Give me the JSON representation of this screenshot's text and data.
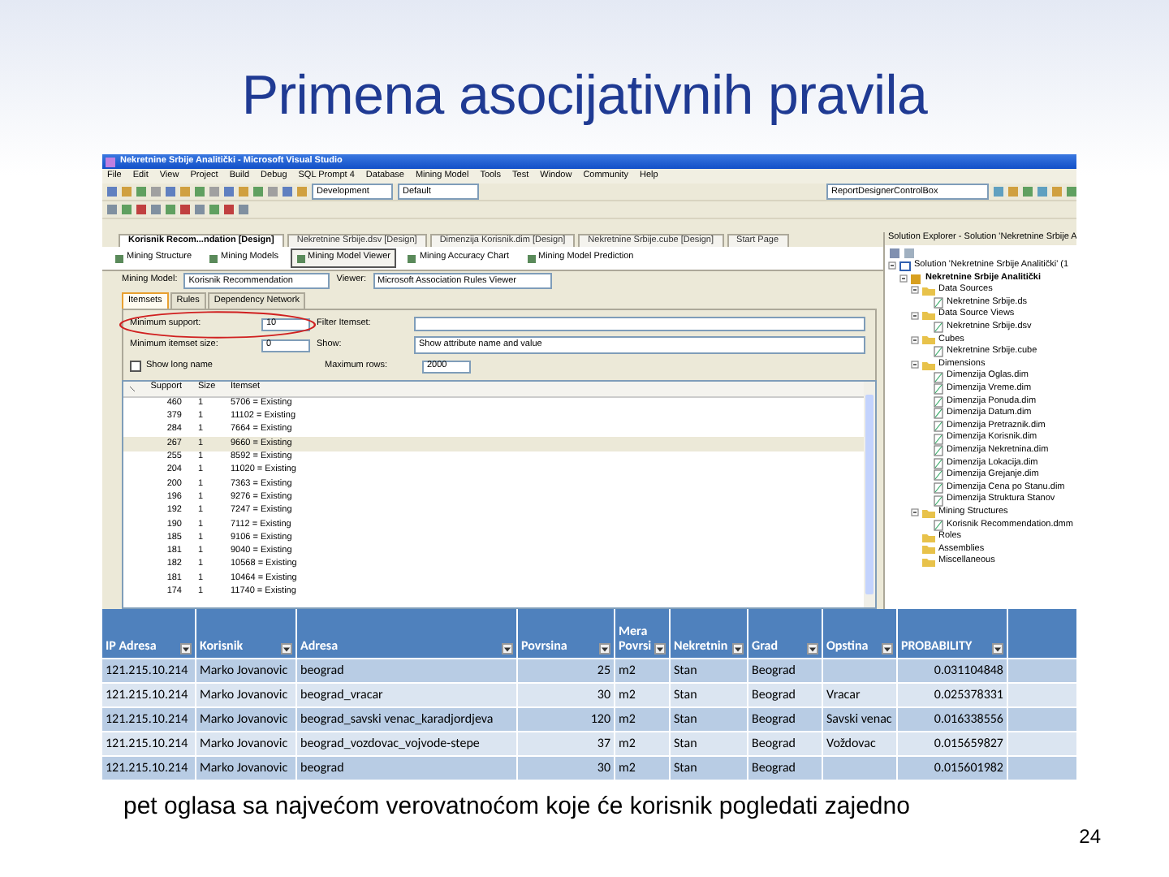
{
  "slide": {
    "title": "Primena asocijativnih pravila",
    "caption": "pet oglasa sa najvećom verovatnoćom  koje će korisnik pogledati zajedno",
    "page_number": "24"
  },
  "window": {
    "title": "Nekretnine Srbije Analitički - Microsoft Visual Studio"
  },
  "menu": [
    "File",
    "Edit",
    "View",
    "Project",
    "Build",
    "Debug",
    "SQL Prompt 4",
    "Database",
    "Mining Model",
    "Tools",
    "Test",
    "Window",
    "Community",
    "Help"
  ],
  "toolbar": {
    "configuration": "Development",
    "platform": "Default",
    "find_box": "ReportDesignerControlBox"
  },
  "document_tabs": [
    {
      "label": "Korisnik Recom...ndation [Design]",
      "selected": true
    },
    {
      "label": "Nekretnine Srbije.dsv [Design]",
      "selected": false
    },
    {
      "label": "Dimenzija Korisnik.dim [Design]",
      "selected": false
    },
    {
      "label": "Nekretnine Srbije.cube [Design]",
      "selected": false
    },
    {
      "label": "Start Page",
      "selected": false
    }
  ],
  "designer_tabs": [
    {
      "label": "Mining Structure",
      "selected": false
    },
    {
      "label": "Mining Models",
      "selected": false
    },
    {
      "label": "Mining Model Viewer",
      "selected": true
    },
    {
      "label": "Mining Accuracy Chart",
      "selected": false
    },
    {
      "label": "Mining Model Prediction",
      "selected": false
    }
  ],
  "mining_model": {
    "label": "Mining Model:",
    "value": "Korisnik Recommendation"
  },
  "viewer": {
    "label": "Viewer:",
    "value": "Microsoft Association Rules Viewer"
  },
  "viewer_tabs": [
    {
      "label": "Itemsets",
      "selected": true
    },
    {
      "label": "Rules",
      "selected": false
    },
    {
      "label": "Dependency Network",
      "selected": false
    }
  ],
  "form": {
    "min_support_label": "Minimum support:",
    "min_support": "10",
    "min_size_label": "Minimum itemset size:",
    "min_size": "0",
    "long_name_label": "Show long name",
    "long_name_checked": false,
    "filter_label": "Filter Itemset:",
    "show_label": "Show:",
    "show_value": "Show attribute name and value",
    "max_rows_label": "Maximum rows:",
    "max_rows": "2000"
  },
  "itemsets": {
    "columns": [
      "Support",
      "Size",
      "Itemset"
    ],
    "rows": [
      {
        "support": "460",
        "size": "1",
        "itemset": "5706 = Existing",
        "selected": false
      },
      {
        "support": "379",
        "size": "1",
        "itemset": "11102 = Existing",
        "selected": false
      },
      {
        "support": "284",
        "size": "1",
        "itemset": "7664 = Existing",
        "selected": false
      },
      {
        "support": "267",
        "size": "1",
        "itemset": "9660 = Existing",
        "selected": true
      },
      {
        "support": "255",
        "size": "1",
        "itemset": "8592 = Existing",
        "selected": false
      },
      {
        "support": "204",
        "size": "1",
        "itemset": "11020 = Existing",
        "selected": false
      },
      {
        "support": "200",
        "size": "1",
        "itemset": "7363 = Existing",
        "selected": false
      },
      {
        "support": "196",
        "size": "1",
        "itemset": "9276 = Existing",
        "selected": false
      },
      {
        "support": "192",
        "size": "1",
        "itemset": "7247 = Existing",
        "selected": false
      },
      {
        "support": "190",
        "size": "1",
        "itemset": "7112 = Existing",
        "selected": false
      },
      {
        "support": "185",
        "size": "1",
        "itemset": "9106 = Existing",
        "selected": false
      },
      {
        "support": "181",
        "size": "1",
        "itemset": "9040 = Existing",
        "selected": false
      },
      {
        "support": "182",
        "size": "1",
        "itemset": "10568 = Existing",
        "selected": false
      },
      {
        "support": "181",
        "size": "1",
        "itemset": "10464 = Existing",
        "selected": false
      },
      {
        "support": "174",
        "size": "1",
        "itemset": "11740 = Existing",
        "selected": false
      }
    ]
  },
  "solution_explorer": {
    "title": "Solution Explorer - Solution 'Nekretnine Srbije A",
    "tree": [
      {
        "label": "Solution 'Nekretnine Srbije Analitički' (1",
        "kind": "solution",
        "expanded": true,
        "children": [
          {
            "label": "Nekretnine Srbije Analitički",
            "kind": "project",
            "expanded": true,
            "children": [
              {
                "label": "Data Sources",
                "kind": "folder",
                "expanded": true,
                "children": [
                  {
                    "label": "Nekretnine Srbije.ds",
                    "kind": "file"
                  }
                ]
              },
              {
                "label": "Data Source Views",
                "kind": "folder",
                "expanded": true,
                "children": [
                  {
                    "label": "Nekretnine Srbije.dsv",
                    "kind": "file"
                  }
                ]
              },
              {
                "label": "Cubes",
                "kind": "folder",
                "expanded": true,
                "children": [
                  {
                    "label": "Nekretnine Srbije.cube",
                    "kind": "file"
                  }
                ]
              },
              {
                "label": "Dimensions",
                "kind": "folder",
                "expanded": true,
                "children": [
                  {
                    "label": "Dimenzija Oglas.dim",
                    "kind": "file"
                  },
                  {
                    "label": "Dimenzija Vreme.dim",
                    "kind": "file"
                  },
                  {
                    "label": "Dimenzija Ponuda.dim",
                    "kind": "file"
                  },
                  {
                    "label": "Dimenzija Datum.dim",
                    "kind": "file"
                  },
                  {
                    "label": "Dimenzija Pretraznik.dim",
                    "kind": "file"
                  },
                  {
                    "label": "Dimenzija Korisnik.dim",
                    "kind": "file"
                  },
                  {
                    "label": "Dimenzija Nekretnina.dim",
                    "kind": "file"
                  },
                  {
                    "label": "Dimenzija Lokacija.dim",
                    "kind": "file"
                  },
                  {
                    "label": "Dimenzija Grejanje.dim",
                    "kind": "file"
                  },
                  {
                    "label": "Dimenzija Cena po Stanu.dim",
                    "kind": "file"
                  },
                  {
                    "label": "Dimenzija Struktura Stanov",
                    "kind": "file"
                  }
                ]
              },
              {
                "label": "Mining Structures",
                "kind": "folder",
                "expanded": true,
                "children": [
                  {
                    "label": "Korisnik Recommendation.dmm",
                    "kind": "file"
                  }
                ]
              },
              {
                "label": "Roles",
                "kind": "folder"
              },
              {
                "label": "Assemblies",
                "kind": "folder"
              },
              {
                "label": "Miscellaneous",
                "kind": "folder"
              }
            ]
          }
        ]
      }
    ]
  },
  "results": {
    "columns": [
      "IP Adresa",
      "Korisnik",
      "Adresa",
      "Povrsina",
      "Mera Povrsi",
      "Nekretnin",
      "Grad",
      "Opstina",
      "PROBABILITY"
    ],
    "rows": [
      [
        "121.215.10.214",
        "Marko Jovanovic",
        "beograd",
        "25",
        "m2",
        "Stan",
        "Beograd",
        null,
        "0.031104848"
      ],
      [
        "121.215.10.214",
        "Marko Jovanovic",
        "beograd_vracar",
        "30",
        "m2",
        "Stan",
        "Beograd",
        "Vracar",
        "0.025378331"
      ],
      [
        "121.215.10.214",
        "Marko Jovanovic",
        "beograd_savski venac_karadjordjeva",
        "120",
        "m2",
        "Stan",
        "Beograd",
        "Savski venac",
        "0.016338556"
      ],
      [
        "121.215.10.214",
        "Marko Jovanovic",
        "beograd_vozdovac_vojvode-stepe",
        "37",
        "m2",
        "Stan",
        "Beograd",
        "Voždovac",
        "0.015659827"
      ],
      [
        "121.215.10.214",
        "Marko Jovanovic",
        "beograd",
        "30",
        "m2",
        "Stan",
        "Beograd",
        null,
        "0.015601982"
      ]
    ]
  }
}
